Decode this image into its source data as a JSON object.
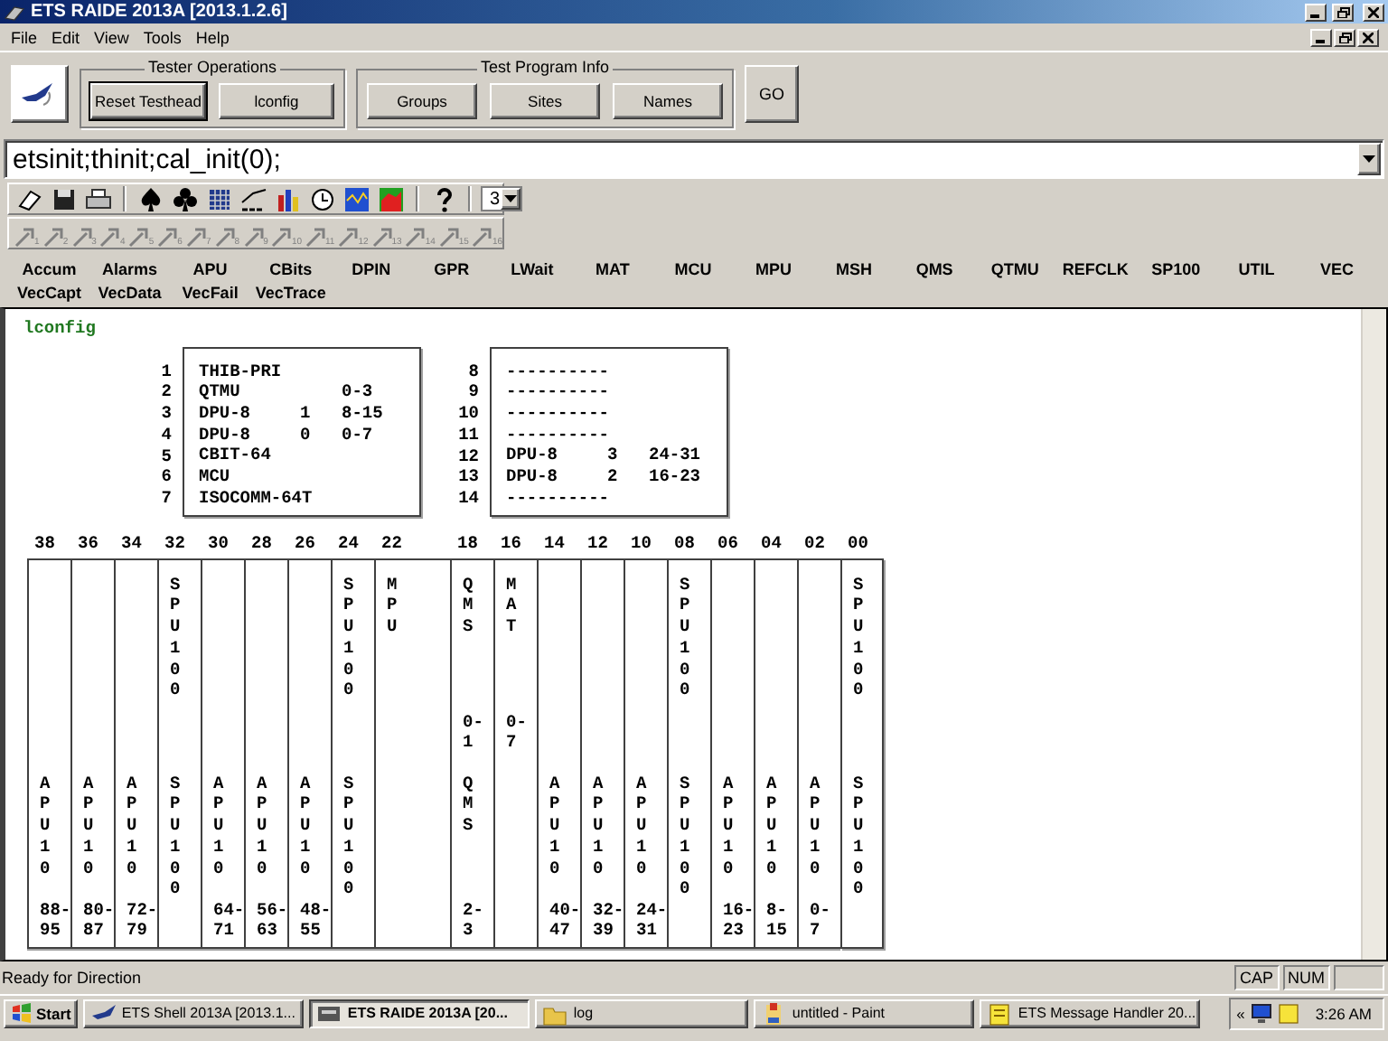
{
  "window": {
    "title": "ETS RAIDE 2013A [2013.1.2.6]"
  },
  "menu": [
    "File",
    "Edit",
    "View",
    "Tools",
    "Help"
  ],
  "groups": [
    {
      "title": "Tester Operations",
      "buttons": [
        {
          "label": "Reset Testhead",
          "focused": true
        },
        {
          "label": "lconfig",
          "focused": false
        }
      ]
    },
    {
      "title": "Test Program Info",
      "buttons": [
        {
          "label": "Groups",
          "focused": false
        },
        {
          "label": "Sites",
          "focused": false
        },
        {
          "label": "Names",
          "focused": false
        }
      ]
    }
  ],
  "go_button": "GO",
  "command": {
    "value": "etsinit;thinit;cal_init(0);"
  },
  "toolbar": {
    "count_select": "3"
  },
  "pin_buttons": [
    "1",
    "2",
    "3",
    "4",
    "5",
    "6",
    "7",
    "8",
    "9",
    "10",
    "11",
    "12",
    "13",
    "14",
    "15",
    "16"
  ],
  "module_tabs": [
    "Accum",
    "Alarms",
    "APU",
    "CBits",
    "DPIN",
    "GPR",
    "LWait",
    "MAT",
    "MCU",
    "MPU",
    "MSH",
    "QMS",
    "QTMU",
    "REFCLK",
    "SP100",
    "UTIL",
    "VEC",
    "VecCapt",
    "VecData",
    "VecFail",
    "VecTrace"
  ],
  "console": {
    "heading": "lconfig",
    "config_left": [
      {
        "number": "1",
        "module": "THIB-PRI"
      },
      {
        "number": "2",
        "module": "QTMU",
        "range": "0-3"
      },
      {
        "number": "3",
        "module": "DPU-8",
        "unit": "1",
        "range": "8-15"
      },
      {
        "number": "4",
        "module": "DPU-8",
        "unit": "0",
        "range": "0-7"
      },
      {
        "number": "5",
        "module": "CBIT-64"
      },
      {
        "number": "6",
        "module": "MCU"
      },
      {
        "number": "7",
        "module": "ISOCOMM-64T"
      }
    ],
    "config_right": [
      {
        "number": "8",
        "module": "----------"
      },
      {
        "number": "9",
        "module": "----------"
      },
      {
        "number": "10",
        "module": "----------"
      },
      {
        "number": "11",
        "module": "----------"
      },
      {
        "number": "12",
        "module": "DPU-8",
        "unit": "3",
        "range": "24-31"
      },
      {
        "number": "13",
        "module": "DPU-8",
        "unit": "2",
        "range": "16-23"
      },
      {
        "number": "14",
        "module": "----------"
      }
    ],
    "slots": [
      {
        "number": "38",
        "kind": "single",
        "bottom": "APU10",
        "range": "88-95"
      },
      {
        "number": "36",
        "kind": "single",
        "bottom": "APU10",
        "range": "80-87"
      },
      {
        "number": "34",
        "kind": "single",
        "bottom": "APU10",
        "range": "72-79"
      },
      {
        "number": "32",
        "kind": "single",
        "top": "SPU100",
        "bottom": "SPU100"
      },
      {
        "number": "30",
        "kind": "single",
        "bottom": "APU10",
        "range": "64-71"
      },
      {
        "number": "28",
        "kind": "single",
        "bottom": "APU10",
        "range": "56-63"
      },
      {
        "number": "26",
        "kind": "single",
        "bottom": "APU10",
        "range": "48-55"
      },
      {
        "number": "24",
        "kind": "single",
        "top": "SPU100",
        "bottom": "SPU100"
      },
      {
        "number": "22",
        "kind": "double",
        "top": "MPU"
      },
      {
        "number": "18",
        "kind": "single",
        "top": "QMS",
        "top_range": "0-1",
        "bottom": "QMS",
        "range": "2-3"
      },
      {
        "number": "16",
        "kind": "single",
        "top": "MAT",
        "top_range": "0-7"
      },
      {
        "number": "14",
        "kind": "single",
        "bottom": "APU10",
        "range": "40-47"
      },
      {
        "number": "12",
        "kind": "single",
        "bottom": "APU10",
        "range": "32-39"
      },
      {
        "number": "10",
        "kind": "single",
        "bottom": "APU10",
        "range": "24-31"
      },
      {
        "number": "08",
        "kind": "single",
        "top": "SPU100",
        "bottom": "SPU100"
      },
      {
        "number": "06",
        "kind": "single",
        "bottom": "APU10",
        "range": "16-23"
      },
      {
        "number": "04",
        "kind": "single",
        "bottom": "APU10",
        "range": "8-15"
      },
      {
        "number": "02",
        "kind": "single",
        "bottom": "APU10",
        "range": "0-7"
      },
      {
        "number": "00",
        "kind": "single",
        "top": "SPU100",
        "bottom": "SPU100"
      }
    ]
  },
  "status_bar": {
    "message": "Ready for Direction",
    "indicators": [
      "CAP",
      "NUM"
    ]
  },
  "taskbar": {
    "start": "Start",
    "tasks": [
      {
        "label": "ETS Shell 2013A [2013.1...",
        "selected": false
      },
      {
        "label": "ETS RAIDE 2013A [20...",
        "selected": true
      },
      {
        "label": "log",
        "selected": false
      },
      {
        "label": "untitled - Paint",
        "selected": false
      },
      {
        "label": "ETS Message Handler 20...",
        "selected": false
      }
    ],
    "tray_chevron": "«",
    "clock": "3:26 AM"
  }
}
